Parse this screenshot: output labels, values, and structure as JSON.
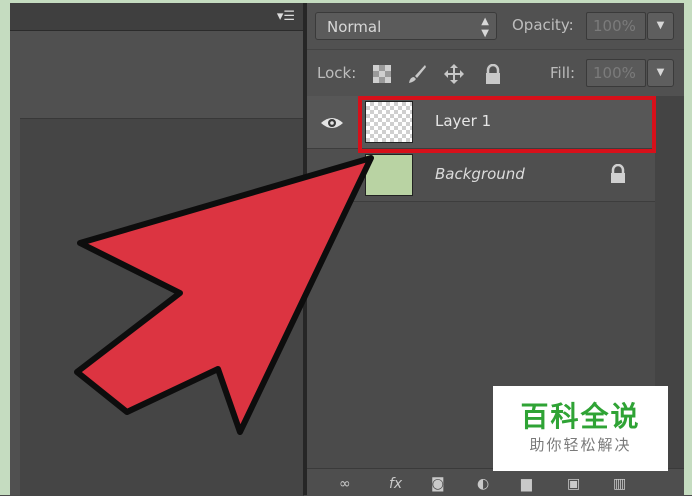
{
  "canvas": {
    "panel_menu_icon": "panel-menu-icon"
  },
  "layers_panel": {
    "blend_mode": "Normal",
    "opacity_label": "Opacity:",
    "opacity_value": "100%",
    "lock_label": "Lock:",
    "fill_label": "Fill:",
    "fill_value": "100%",
    "lock_icons": [
      "lock-transparent-pixels-icon",
      "lock-image-pixels-icon",
      "lock-position-icon",
      "lock-all-icon"
    ],
    "layers": [
      {
        "name": "Layer 1",
        "visible": true,
        "selected": true,
        "thumbnail": "transparent"
      },
      {
        "name": "Background",
        "visible": false,
        "locked": true,
        "thumbnail": "#b9d3a3"
      }
    ],
    "bottom_icons": [
      "link-layers-icon",
      "fx-icon",
      "add-mask-icon",
      "adjustment-layer-icon",
      "new-group-icon",
      "new-layer-icon",
      "delete-layer-icon"
    ]
  },
  "annotation": {
    "highlight_color": "#d7101a",
    "arrow_color": "#dc3441"
  },
  "watermark": {
    "title": "百科全说",
    "subtitle": "助你轻松解决",
    "title_color": "#2fa335"
  }
}
